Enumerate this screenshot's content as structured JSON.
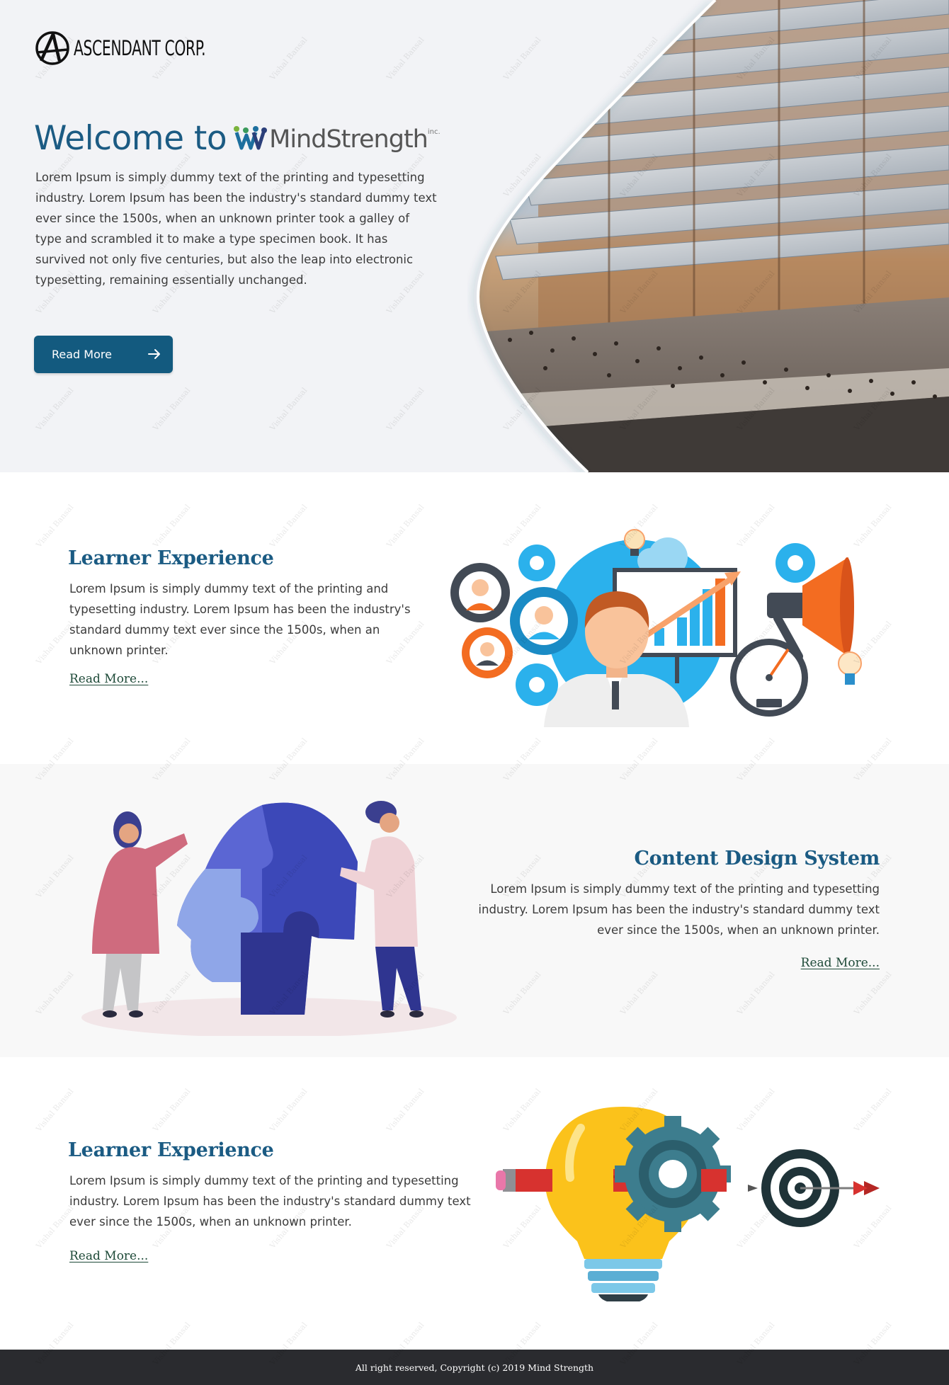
{
  "brand": {
    "name": "ASCENDANT CORP."
  },
  "hero": {
    "welcome": "Welcome to",
    "logo_word": "MindStrength",
    "logo_suffix": "inc.",
    "body": "Lorem Ipsum is simply dummy text of the printing and typesetting industry. Lorem Ipsum has been the industry's standard dummy text ever since the 1500s, when an unknown printer took a galley of type and scrambled it to make a type specimen book. It has survived not only five centuries, but also the leap into electronic typesetting, remaining essentially unchanged.",
    "button_label": "Read More"
  },
  "sections": [
    {
      "title": "Learner Experience",
      "body": "Lorem Ipsum is simply dummy text of the printing and typesetting industry. Lorem Ipsum has been the industry's standard dummy text ever since the 1500s, when an unknown printer.",
      "link": "Read More..."
    },
    {
      "title": "Content Design System",
      "body": "Lorem Ipsum is simply dummy text of the printing and  typesetting industry. Lorem Ipsum has been the industry's standard dummy text ever since the 1500s, when an  unknown printer.",
      "link": "Read More..."
    },
    {
      "title": "Learner Experience",
      "body": "Lorem Ipsum is simply dummy text of the printing and typesetting industry. Lorem Ipsum has been the industry's standard dummy text ever since the 1500s, when an unknown printer.",
      "link": "Read More..."
    }
  ],
  "footer": {
    "text": "All right reserved, Copyright (c) 2019 Mind Strength"
  },
  "watermark": "Vishal Bansal",
  "colors": {
    "primary": "#135a7f",
    "title": "#1b5b83",
    "link": "#1e4a38",
    "footer": "#2a2b2f",
    "hero_bg": "#f2f3f6"
  },
  "icons": [
    "anarchy-a-logo-icon",
    "mindstrength-logo-icon",
    "arrow-right-icon",
    "gears-analytics-illustration",
    "puzzle-head-illustration",
    "lightbulb-target-illustration"
  ]
}
